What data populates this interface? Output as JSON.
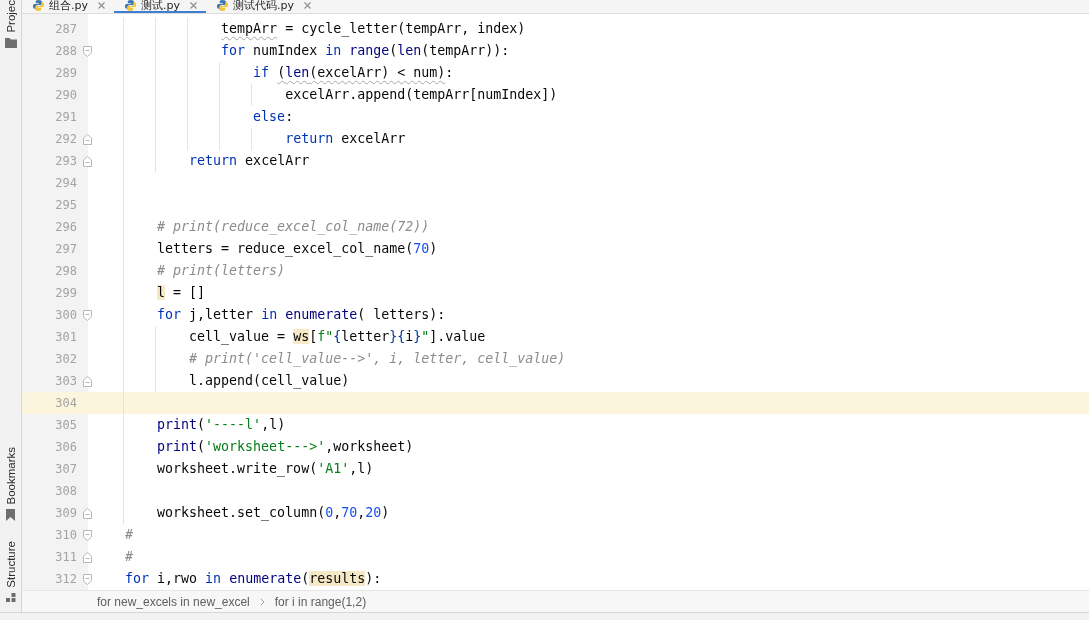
{
  "tool_windows": {
    "top": [
      {
        "label": "Projec"
      }
    ],
    "bottom": [
      {
        "label": "Bookmarks"
      },
      {
        "label": "Structure"
      }
    ]
  },
  "tabs": [
    {
      "label": "组合.py",
      "selected": false
    },
    {
      "label": "测试.py",
      "selected": true
    },
    {
      "label": "测试代码.py",
      "selected": false
    }
  ],
  "editor": {
    "lines": [
      {
        "children": [
          {
            "children": [
              {
                "children": [
                  {
                    "children": [
                      {
                        "number": "287",
                        "current": false,
                        "fold_start": false,
                        "fold_end": false,
                        "tokens": [
                          {
                            "kind": "warning",
                            "children": [
                              {
                                "kind": "plain",
                                "text": "tempArr"
                              }
                            ]
                          },
                          {
                            "kind": "plain",
                            "text": " = cycle_letter(tempArr, index)"
                          }
                        ]
                      },
                      {
                        "number": "288",
                        "current": false,
                        "fold_start": true,
                        "fold_end": false,
                        "tokens": [
                          {
                            "kind": "keyword",
                            "text": "for"
                          },
                          {
                            "kind": "plain",
                            "text": " numIndex "
                          },
                          {
                            "kind": "keyword",
                            "text": "in "
                          },
                          {
                            "kind": "builtin",
                            "text": "range"
                          },
                          {
                            "kind": "plain",
                            "text": "("
                          },
                          {
                            "kind": "builtin",
                            "text": "len"
                          },
                          {
                            "kind": "plain",
                            "text": "(tempArr)):"
                          }
                        ],
                        "children": [
                          {
                            "number": "289",
                            "current": false,
                            "fold_start": false,
                            "fold_end": false,
                            "tokens": [
                              {
                                "kind": "keyword",
                                "text": "if "
                              },
                              {
                                "kind": "warning",
                                "children": [
                                  {
                                    "kind": "plain",
                                    "text": "("
                                  },
                                  {
                                    "kind": "builtin",
                                    "text": "len"
                                  },
                                  {
                                    "kind": "plain",
                                    "text": "(excelArr) < num)"
                                  }
                                ]
                              },
                              {
                                "kind": "plain",
                                "text": ":"
                              }
                            ],
                            "children": [
                              {
                                "number": "290",
                                "current": false,
                                "fold_start": false,
                                "fold_end": false,
                                "tokens": [
                                  {
                                    "kind": "plain",
                                    "text": "excelArr.append(tempArr[numIndex])"
                                  }
                                ]
                              }
                            ]
                          },
                          {
                            "number": "291",
                            "current": false,
                            "fold_start": false,
                            "fold_end": false,
                            "tokens": [
                              {
                                "kind": "keyword",
                                "text": "else"
                              },
                              {
                                "kind": "plain",
                                "text": ":"
                              }
                            ],
                            "children": [
                              {
                                "number": "292",
                                "current": false,
                                "fold_start": false,
                                "fold_end": true,
                                "tokens": [
                                  {
                                    "kind": "keyword",
                                    "text": "return"
                                  },
                                  {
                                    "kind": "plain",
                                    "text": " excelArr"
                                  }
                                ]
                              }
                            ]
                          }
                        ]
                      }
                    ]
                  },
                  {
                    "number": "293",
                    "current": false,
                    "fold_start": false,
                    "fold_end": true,
                    "tokens": [
                      {
                        "kind": "keyword",
                        "text": "return"
                      },
                      {
                        "kind": "plain",
                        "text": " excelArr"
                      }
                    ]
                  }
                ]
              },
              {
                "number": "294",
                "current": false,
                "fold_start": false,
                "fold_end": false
              },
              {
                "number": "295",
                "current": false,
                "fold_start": false,
                "fold_end": false
              },
              {
                "number": "296",
                "current": false,
                "fold_start": false,
                "fold_end": false,
                "tokens": [
                  {
                    "kind": "comment",
                    "text": "# print(reduce_excel_col_name(72))"
                  }
                ]
              },
              {
                "number": "297",
                "current": false,
                "fold_start": false,
                "fold_end": false,
                "tokens": [
                  {
                    "kind": "plain",
                    "text": "letters = reduce_excel_col_name("
                  },
                  {
                    "kind": "number",
                    "text": "70"
                  },
                  {
                    "kind": "plain",
                    "text": ")"
                  }
                ]
              },
              {
                "number": "298",
                "current": false,
                "fold_start": false,
                "fold_end": false,
                "tokens": [
                  {
                    "kind": "comment",
                    "text": "# print(letters)"
                  }
                ]
              },
              {
                "number": "299",
                "current": false,
                "fold_start": false,
                "fold_end": false,
                "tokens": [
                  {
                    "kind": "highlight",
                    "text": "l"
                  },
                  {
                    "kind": "plain",
                    "text": " = []"
                  }
                ]
              },
              {
                "number": "300",
                "current": false,
                "fold_start": true,
                "fold_end": false,
                "tokens": [
                  {
                    "kind": "keyword",
                    "text": "for"
                  },
                  {
                    "kind": "plain",
                    "text": " j,letter "
                  },
                  {
                    "kind": "keyword",
                    "text": "in "
                  },
                  {
                    "kind": "builtin",
                    "text": "enumerate"
                  },
                  {
                    "kind": "plain",
                    "text": "( letters):"
                  }
                ],
                "children": [
                  {
                    "number": "301",
                    "current": false,
                    "fold_start": false,
                    "fold_end": false,
                    "tokens": [
                      {
                        "kind": "plain",
                        "text": "cell_value = "
                      },
                      {
                        "kind": "highlight",
                        "text": "ws"
                      },
                      {
                        "kind": "plain",
                        "text": "["
                      },
                      {
                        "kind": "string",
                        "text": "f\""
                      },
                      {
                        "kind": "brace",
                        "text": "{"
                      },
                      {
                        "kind": "plain",
                        "text": "letter"
                      },
                      {
                        "kind": "brace",
                        "text": "}"
                      },
                      {
                        "kind": "brace",
                        "text": "{"
                      },
                      {
                        "kind": "plain",
                        "text": "i"
                      },
                      {
                        "kind": "brace",
                        "text": "}"
                      },
                      {
                        "kind": "string",
                        "text": "\""
                      },
                      {
                        "kind": "plain",
                        "text": "].value"
                      }
                    ]
                  },
                  {
                    "number": "302",
                    "current": false,
                    "fold_start": false,
                    "fold_end": false,
                    "tokens": [
                      {
                        "kind": "comment",
                        "text": "# print('cell_value-->', i, letter, cell_value)"
                      }
                    ]
                  },
                  {
                    "number": "303",
                    "current": false,
                    "fold_start": false,
                    "fold_end": true,
                    "tokens": [
                      {
                        "kind": "plain",
                        "text": "l.append(cell_value)"
                      }
                    ]
                  }
                ]
              },
              {
                "number": "304",
                "current": true,
                "fold_start": false,
                "fold_end": false
              },
              {
                "number": "305",
                "current": false,
                "fold_start": false,
                "fold_end": false,
                "tokens": [
                  {
                    "kind": "builtin",
                    "text": "print"
                  },
                  {
                    "kind": "plain",
                    "text": "("
                  },
                  {
                    "kind": "string",
                    "text": "'----l'"
                  },
                  {
                    "kind": "plain",
                    "text": ",l)"
                  }
                ]
              },
              {
                "number": "306",
                "current": false,
                "fold_start": false,
                "fold_end": false,
                "tokens": [
                  {
                    "kind": "builtin",
                    "text": "print"
                  },
                  {
                    "kind": "plain",
                    "text": "("
                  },
                  {
                    "kind": "string",
                    "text": "'worksheet--->'"
                  },
                  {
                    "kind": "plain",
                    "text": ",worksheet)"
                  }
                ]
              },
              {
                "number": "307",
                "current": false,
                "fold_start": false,
                "fold_end": false,
                "tokens": [
                  {
                    "kind": "plain",
                    "text": "worksheet.write_row("
                  },
                  {
                    "kind": "string",
                    "text": "'A1'"
                  },
                  {
                    "kind": "plain",
                    "text": ",l)"
                  }
                ]
              },
              {
                "number": "308",
                "current": false,
                "fold_start": false,
                "fold_end": false
              },
              {
                "number": "309",
                "current": false,
                "fold_start": false,
                "fold_end": true,
                "tokens": [
                  {
                    "kind": "plain",
                    "text": "worksheet.set_column("
                  },
                  {
                    "kind": "number",
                    "text": "0"
                  },
                  {
                    "kind": "plain",
                    "text": ","
                  },
                  {
                    "kind": "number",
                    "text": "70"
                  },
                  {
                    "kind": "plain",
                    "text": ","
                  },
                  {
                    "kind": "number",
                    "text": "20"
                  },
                  {
                    "kind": "plain",
                    "text": ")"
                  }
                ]
              }
            ]
          },
          {
            "number": "310",
            "current": false,
            "fold_start": true,
            "fold_end": false,
            "tokens": [
              {
                "kind": "comment",
                "text": "#"
              }
            ]
          },
          {
            "number": "311",
            "current": false,
            "fold_start": false,
            "fold_end": true,
            "tokens": [
              {
                "kind": "comment",
                "text": "#"
              }
            ]
          },
          {
            "number": "312",
            "current": false,
            "fold_start": true,
            "fold_end": false,
            "tokens": [
              {
                "kind": "keyword",
                "text": "for"
              },
              {
                "kind": "plain",
                "text": " i,rwo "
              },
              {
                "kind": "keyword",
                "text": "in "
              },
              {
                "kind": "builtin",
                "text": "enumerate"
              },
              {
                "kind": "plain",
                "text": "("
              },
              {
                "kind": "highlight",
                "text": "results"
              },
              {
                "kind": "plain",
                "text": "):"
              }
            ]
          }
        ]
      }
    ]
  },
  "breadcrumbs": [
    "for new_excels in new_excel",
    "for i in range(1,2)"
  ]
}
